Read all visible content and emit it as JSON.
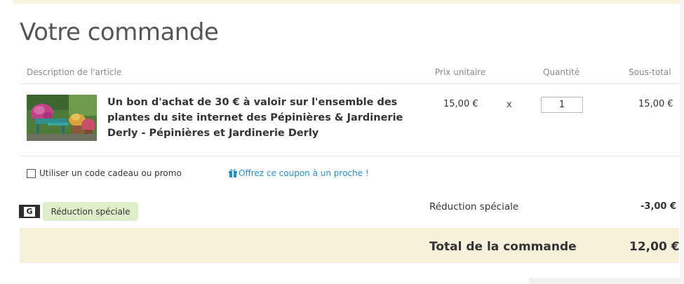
{
  "page": {
    "title": "Votre commande"
  },
  "table": {
    "headers": {
      "description": "Description de l'article",
      "unit_price": "Prix unitaire",
      "quantity": "Quantité",
      "subtotal": "Sous-total"
    },
    "items": [
      {
        "image_icon": "flower-garden-photo",
        "name": "Un bon d'achat de 30 € à valoir sur l'ensemble des plantes du site internet des Pépinières & Jardinerie Derly - Pépinières et Jardinerie Derly",
        "unit_price": "15,00 €",
        "times": "x",
        "quantity": "1",
        "subtotal": "15,00 €"
      }
    ]
  },
  "promo": {
    "checkbox_label": "Utiliser un code cadeau ou promo",
    "checked": false,
    "gift_link": "Offrez ce coupon à un proche !",
    "gift_icon": "gift-icon"
  },
  "discount": {
    "badge_letter": "G",
    "tag_label": "Réduction spéciale",
    "label": "Réduction spéciale",
    "amount": "-3,00 €"
  },
  "totals": {
    "label": "Total de la commande",
    "amount": "12,00 €"
  },
  "colors": {
    "accent_link": "#1f8fc9",
    "total_band": "#f7f1dc",
    "discount_tag": "#dfeec8"
  }
}
